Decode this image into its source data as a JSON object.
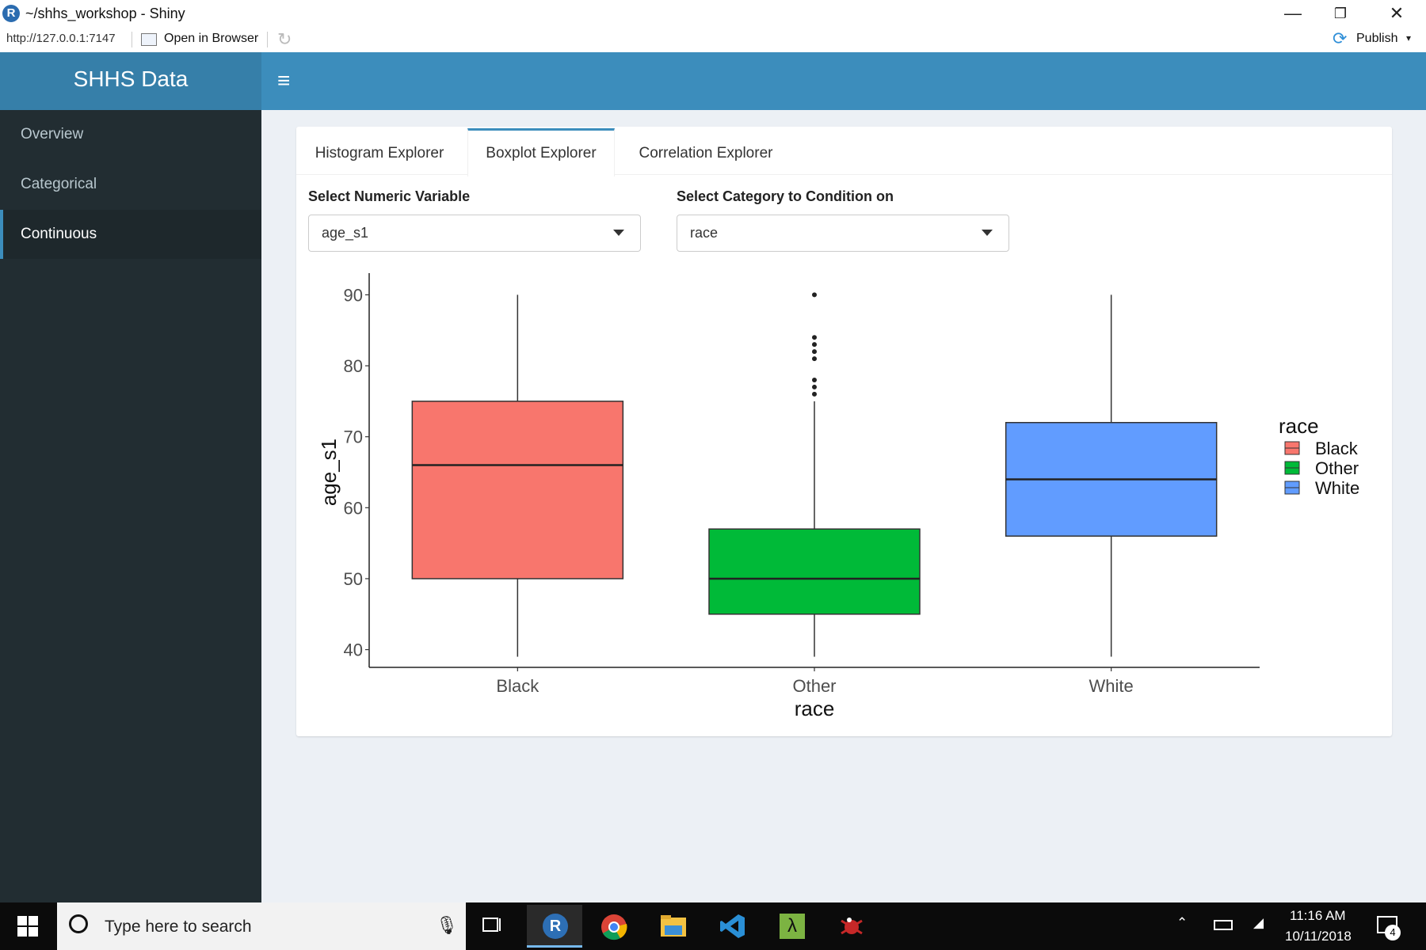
{
  "window": {
    "title": "~/shhs_workshop - Shiny",
    "minimize": "—",
    "restore": "❐",
    "close": "✕"
  },
  "addressbar": {
    "url": "http://127.0.0.1:7147",
    "open_in_browser": "Open in Browser",
    "publish": "Publish"
  },
  "header": {
    "logo": "SHHS Data",
    "menu_icon": "≡"
  },
  "sidebar": {
    "items": [
      {
        "label": "Overview"
      },
      {
        "label": "Categorical"
      },
      {
        "label": "Continuous"
      }
    ],
    "active_index": 2
  },
  "tabs": [
    {
      "label": "Histogram Explorer"
    },
    {
      "label": "Boxplot Explorer"
    },
    {
      "label": "Correlation Explorer"
    }
  ],
  "active_tab": 1,
  "controls": {
    "numeric": {
      "label": "Select Numeric Variable",
      "value": "age_s1"
    },
    "category": {
      "label": "Select Category to Condition on",
      "value": "race"
    }
  },
  "chart_data": {
    "type": "boxplot",
    "xlabel": "race",
    "ylabel": "age_s1",
    "ylim": [
      37.5,
      92.5
    ],
    "yticks": [
      40,
      50,
      60,
      70,
      80,
      90
    ],
    "categories": [
      "Black",
      "Other",
      "White"
    ],
    "series": [
      {
        "name": "Black",
        "color": "#f8766d",
        "whisker_low": 39,
        "q1": 50,
        "median": 66,
        "q3": 75,
        "whisker_high": 90,
        "outliers": []
      },
      {
        "name": "Other",
        "color": "#00ba38",
        "whisker_low": 39,
        "q1": 45,
        "median": 50,
        "q3": 57,
        "whisker_high": 75,
        "outliers": [
          76,
          77,
          78,
          81,
          82,
          83,
          84,
          90
        ]
      },
      {
        "name": "White",
        "color": "#619cff",
        "whisker_low": 39,
        "q1": 56,
        "median": 64,
        "q3": 72,
        "whisker_high": 90,
        "outliers": []
      }
    ],
    "legend": {
      "title": "race",
      "position": "right",
      "entries": [
        "Black",
        "Other",
        "White"
      ]
    }
  },
  "taskbar": {
    "search_placeholder": "Type here to search",
    "time": "11:16 AM",
    "date": "10/11/2018",
    "notifications": "4"
  }
}
